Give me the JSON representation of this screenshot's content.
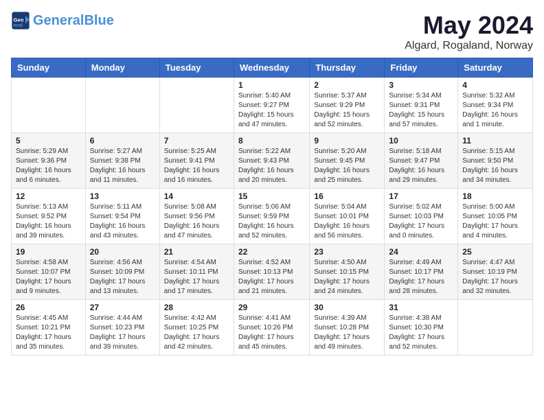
{
  "logo": {
    "text_general": "General",
    "text_blue": "Blue"
  },
  "title": "May 2024",
  "subtitle": "Algard, Rogaland, Norway",
  "weekdays": [
    "Sunday",
    "Monday",
    "Tuesday",
    "Wednesday",
    "Thursday",
    "Friday",
    "Saturday"
  ],
  "weeks": [
    [
      {
        "day": "",
        "info": ""
      },
      {
        "day": "",
        "info": ""
      },
      {
        "day": "",
        "info": ""
      },
      {
        "day": "1",
        "info": "Sunrise: 5:40 AM\nSunset: 9:27 PM\nDaylight: 15 hours\nand 47 minutes."
      },
      {
        "day": "2",
        "info": "Sunrise: 5:37 AM\nSunset: 9:29 PM\nDaylight: 15 hours\nand 52 minutes."
      },
      {
        "day": "3",
        "info": "Sunrise: 5:34 AM\nSunset: 9:31 PM\nDaylight: 15 hours\nand 57 minutes."
      },
      {
        "day": "4",
        "info": "Sunrise: 5:32 AM\nSunset: 9:34 PM\nDaylight: 16 hours\nand 1 minute."
      }
    ],
    [
      {
        "day": "5",
        "info": "Sunrise: 5:29 AM\nSunset: 9:36 PM\nDaylight: 16 hours\nand 6 minutes."
      },
      {
        "day": "6",
        "info": "Sunrise: 5:27 AM\nSunset: 9:38 PM\nDaylight: 16 hours\nand 11 minutes."
      },
      {
        "day": "7",
        "info": "Sunrise: 5:25 AM\nSunset: 9:41 PM\nDaylight: 16 hours\nand 16 minutes."
      },
      {
        "day": "8",
        "info": "Sunrise: 5:22 AM\nSunset: 9:43 PM\nDaylight: 16 hours\nand 20 minutes."
      },
      {
        "day": "9",
        "info": "Sunrise: 5:20 AM\nSunset: 9:45 PM\nDaylight: 16 hours\nand 25 minutes."
      },
      {
        "day": "10",
        "info": "Sunrise: 5:18 AM\nSunset: 9:47 PM\nDaylight: 16 hours\nand 29 minutes."
      },
      {
        "day": "11",
        "info": "Sunrise: 5:15 AM\nSunset: 9:50 PM\nDaylight: 16 hours\nand 34 minutes."
      }
    ],
    [
      {
        "day": "12",
        "info": "Sunrise: 5:13 AM\nSunset: 9:52 PM\nDaylight: 16 hours\nand 39 minutes."
      },
      {
        "day": "13",
        "info": "Sunrise: 5:11 AM\nSunset: 9:54 PM\nDaylight: 16 hours\nand 43 minutes."
      },
      {
        "day": "14",
        "info": "Sunrise: 5:08 AM\nSunset: 9:56 PM\nDaylight: 16 hours\nand 47 minutes."
      },
      {
        "day": "15",
        "info": "Sunrise: 5:06 AM\nSunset: 9:59 PM\nDaylight: 16 hours\nand 52 minutes."
      },
      {
        "day": "16",
        "info": "Sunrise: 5:04 AM\nSunset: 10:01 PM\nDaylight: 16 hours\nand 56 minutes."
      },
      {
        "day": "17",
        "info": "Sunrise: 5:02 AM\nSunset: 10:03 PM\nDaylight: 17 hours\nand 0 minutes."
      },
      {
        "day": "18",
        "info": "Sunrise: 5:00 AM\nSunset: 10:05 PM\nDaylight: 17 hours\nand 4 minutes."
      }
    ],
    [
      {
        "day": "19",
        "info": "Sunrise: 4:58 AM\nSunset: 10:07 PM\nDaylight: 17 hours\nand 9 minutes."
      },
      {
        "day": "20",
        "info": "Sunrise: 4:56 AM\nSunset: 10:09 PM\nDaylight: 17 hours\nand 13 minutes."
      },
      {
        "day": "21",
        "info": "Sunrise: 4:54 AM\nSunset: 10:11 PM\nDaylight: 17 hours\nand 17 minutes."
      },
      {
        "day": "22",
        "info": "Sunrise: 4:52 AM\nSunset: 10:13 PM\nDaylight: 17 hours\nand 21 minutes."
      },
      {
        "day": "23",
        "info": "Sunrise: 4:50 AM\nSunset: 10:15 PM\nDaylight: 17 hours\nand 24 minutes."
      },
      {
        "day": "24",
        "info": "Sunrise: 4:49 AM\nSunset: 10:17 PM\nDaylight: 17 hours\nand 28 minutes."
      },
      {
        "day": "25",
        "info": "Sunrise: 4:47 AM\nSunset: 10:19 PM\nDaylight: 17 hours\nand 32 minutes."
      }
    ],
    [
      {
        "day": "26",
        "info": "Sunrise: 4:45 AM\nSunset: 10:21 PM\nDaylight: 17 hours\nand 35 minutes."
      },
      {
        "day": "27",
        "info": "Sunrise: 4:44 AM\nSunset: 10:23 PM\nDaylight: 17 hours\nand 39 minutes."
      },
      {
        "day": "28",
        "info": "Sunrise: 4:42 AM\nSunset: 10:25 PM\nDaylight: 17 hours\nand 42 minutes."
      },
      {
        "day": "29",
        "info": "Sunrise: 4:41 AM\nSunset: 10:26 PM\nDaylight: 17 hours\nand 45 minutes."
      },
      {
        "day": "30",
        "info": "Sunrise: 4:39 AM\nSunset: 10:28 PM\nDaylight: 17 hours\nand 49 minutes."
      },
      {
        "day": "31",
        "info": "Sunrise: 4:38 AM\nSunset: 10:30 PM\nDaylight: 17 hours\nand 52 minutes."
      },
      {
        "day": "",
        "info": ""
      }
    ]
  ]
}
